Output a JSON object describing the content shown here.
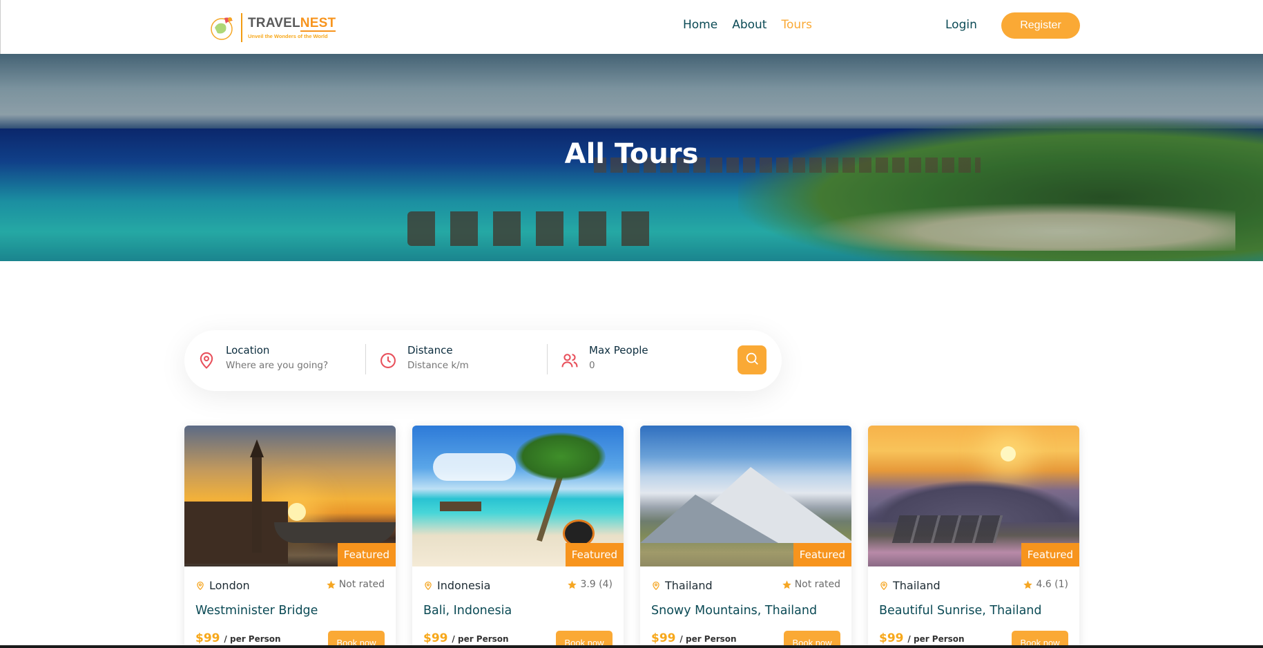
{
  "brand": {
    "name_part1": "TRAVEL",
    "name_part2": "NEST",
    "tagline": "Unveil the Wonders of the World"
  },
  "nav": {
    "items": [
      {
        "label": "Home",
        "active": false
      },
      {
        "label": "About",
        "active": false
      },
      {
        "label": "Tours",
        "active": true
      }
    ],
    "login_label": "Login",
    "register_label": "Register"
  },
  "hero": {
    "title": "All Tours"
  },
  "search": {
    "fields": [
      {
        "label": "Location",
        "placeholder": "Where are you going?",
        "icon": "map-pin-icon"
      },
      {
        "label": "Distance",
        "placeholder": "Distance k/m",
        "icon": "clock-icon"
      },
      {
        "label": "Max People",
        "placeholder": "0",
        "icon": "users-icon"
      }
    ],
    "button_icon": "search-icon"
  },
  "tours": [
    {
      "badge": "Featured",
      "city": "London",
      "rating": "Not rated",
      "title": "Westminister Bridge",
      "price": "$99",
      "per": "/ per Person",
      "book_label": "Book now"
    },
    {
      "badge": "Featured",
      "city": "Indonesia",
      "rating": "3.9 (4)",
      "title": "Bali, Indonesia",
      "price": "$99",
      "per": "/ per Person",
      "book_label": "Book now"
    },
    {
      "badge": "Featured",
      "city": "Thailand",
      "rating": "Not rated",
      "title": "Snowy Mountains, Thailand",
      "price": "$99",
      "per": "/ per Person",
      "book_label": "Book now"
    },
    {
      "badge": "Featured",
      "city": "Thailand",
      "rating": "4.6 (1)",
      "title": "Beautiful Sunrise, Thailand",
      "price": "$99",
      "per": "/ per Person",
      "book_label": "Book now"
    }
  ],
  "colors": {
    "accent": "#faa935",
    "badge": "#f7941d",
    "nav_text": "#0b4a55",
    "icon_red": "#e8505b"
  }
}
